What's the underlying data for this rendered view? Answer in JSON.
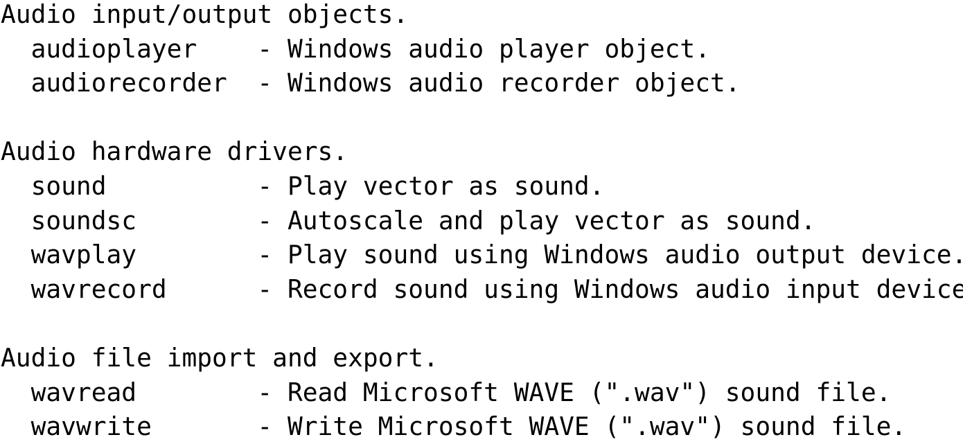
{
  "document": {
    "kind": "console-text-listing",
    "background_color": "#ffffff",
    "text_color": "#000000",
    "full_text": "Audio input/output objects.\n  audioplayer    - Windows audio player object.\n  audiorecorder  - Windows audio recorder object.\n\nAudio hardware drivers.\n  sound          - Play vector as sound.\n  soundsc        - Autoscale and play vector as sound.\n  wavplay        - Play sound using Windows audio output device.\n  wavrecord      - Record sound using Windows audio input device.\n\nAudio file import and export.\n  wavread        - Read Microsoft WAVE (\".wav\") sound file.\n  wavwrite       - Write Microsoft WAVE (\".wav\") sound file.",
    "lines": [
      "Audio input/output objects.",
      "  audioplayer    - Windows audio player object.",
      "  audiorecorder  - Windows audio recorder object.",
      "",
      "Audio hardware drivers.",
      "  sound          - Play vector as sound.",
      "  soundsc        - Autoscale and play vector as sound.",
      "  wavplay        - Play sound using Windows audio output device.",
      "  wavrecord      - Record sound using Windows audio input device.",
      "",
      "Audio file import and export.",
      "  wavread        - Read Microsoft WAVE (\".wav\") sound file.",
      "  wavwrite       - Write Microsoft WAVE (\".wav\") sound file."
    ],
    "sections": [
      {
        "heading": "Audio input/output objects.",
        "entries": [
          {
            "name": "audioplayer",
            "separator": "-",
            "description": "Windows audio player object."
          },
          {
            "name": "audiorecorder",
            "separator": "-",
            "description": "Windows audio recorder object."
          }
        ]
      },
      {
        "heading": "Audio hardware drivers.",
        "entries": [
          {
            "name": "sound",
            "separator": "-",
            "description": "Play vector as sound."
          },
          {
            "name": "soundsc",
            "separator": "-",
            "description": "Autoscale and play vector as sound."
          },
          {
            "name": "wavplay",
            "separator": "-",
            "description": "Play sound using Windows audio output device."
          },
          {
            "name": "wavrecord",
            "separator": "-",
            "description": "Record sound using Windows audio input device."
          }
        ]
      },
      {
        "heading": "Audio file import and export.",
        "entries": [
          {
            "name": "wavread",
            "separator": "-",
            "description": "Read Microsoft WAVE (\".wav\") sound file."
          },
          {
            "name": "wavwrite",
            "separator": "-",
            "description": "Write Microsoft WAVE (\".wav\") sound file."
          }
        ]
      }
    ]
  }
}
